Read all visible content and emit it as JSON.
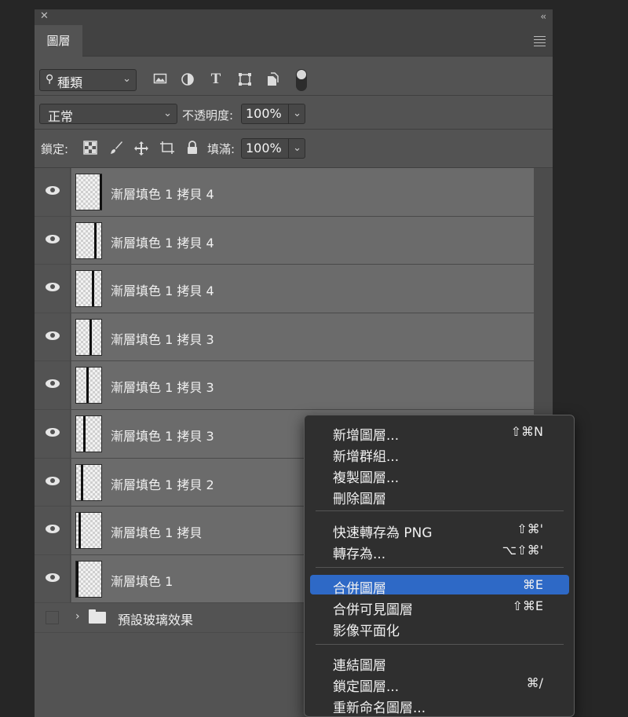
{
  "panel": {
    "close_glyph": "✕",
    "collapse_glyph": "‹‹",
    "tab_label": "圖層"
  },
  "filter": {
    "kind_label": "種類",
    "icons": [
      "image-filter-icon",
      "adjustment-filter-icon",
      "type-filter-icon",
      "shape-filter-icon",
      "smart-object-filter-icon"
    ]
  },
  "blend": {
    "mode": "正常",
    "opacity_label": "不透明度:",
    "opacity_value": "100%"
  },
  "locks": {
    "label": "鎖定:",
    "fill_label": "填滿:",
    "fill_value": "100%"
  },
  "layers": [
    {
      "name": "漸層填色 1 拷貝 4",
      "visible": true
    },
    {
      "name": "漸層填色 1 拷貝 4",
      "visible": true
    },
    {
      "name": "漸層填色 1 拷貝 4",
      "visible": true
    },
    {
      "name": "漸層填色 1 拷貝 3",
      "visible": true
    },
    {
      "name": "漸層填色 1 拷貝 3",
      "visible": true
    },
    {
      "name": "漸層填色 1 拷貝 3",
      "visible": true
    },
    {
      "name": "漸層填色 1 拷貝 2",
      "visible": true
    },
    {
      "name": "漸層填色 1 拷貝",
      "visible": true
    },
    {
      "name": "漸層填色 1",
      "visible": true
    }
  ],
  "group": {
    "name": "預設玻璃效果",
    "visible": false
  },
  "context_menu": {
    "sections": [
      [
        {
          "label": "新增圖層...",
          "shortcut": "⇧⌘N"
        },
        {
          "label": "新增群組...",
          "shortcut": ""
        },
        {
          "label": "複製圖層...",
          "shortcut": ""
        },
        {
          "label": "刪除圖層",
          "shortcut": ""
        }
      ],
      [
        {
          "label": "快速轉存為 PNG",
          "shortcut": "⇧⌘'"
        },
        {
          "label": "轉存為...",
          "shortcut": "⌥⇧⌘'"
        }
      ],
      [
        {
          "label": "合併圖層",
          "shortcut": "⌘E",
          "selected": true
        },
        {
          "label": "合併可見圖層",
          "shortcut": "⇧⌘E"
        },
        {
          "label": "影像平面化",
          "shortcut": ""
        }
      ],
      [
        {
          "label": "連結圖層",
          "shortcut": ""
        },
        {
          "label": "鎖定圖層...",
          "shortcut": "⌘/"
        },
        {
          "label": "重新命名圖層...",
          "shortcut": ""
        }
      ]
    ]
  },
  "colors": {
    "selection": "#2e69c6",
    "panel": "#535353",
    "layer_row": "#6b6b6b"
  }
}
